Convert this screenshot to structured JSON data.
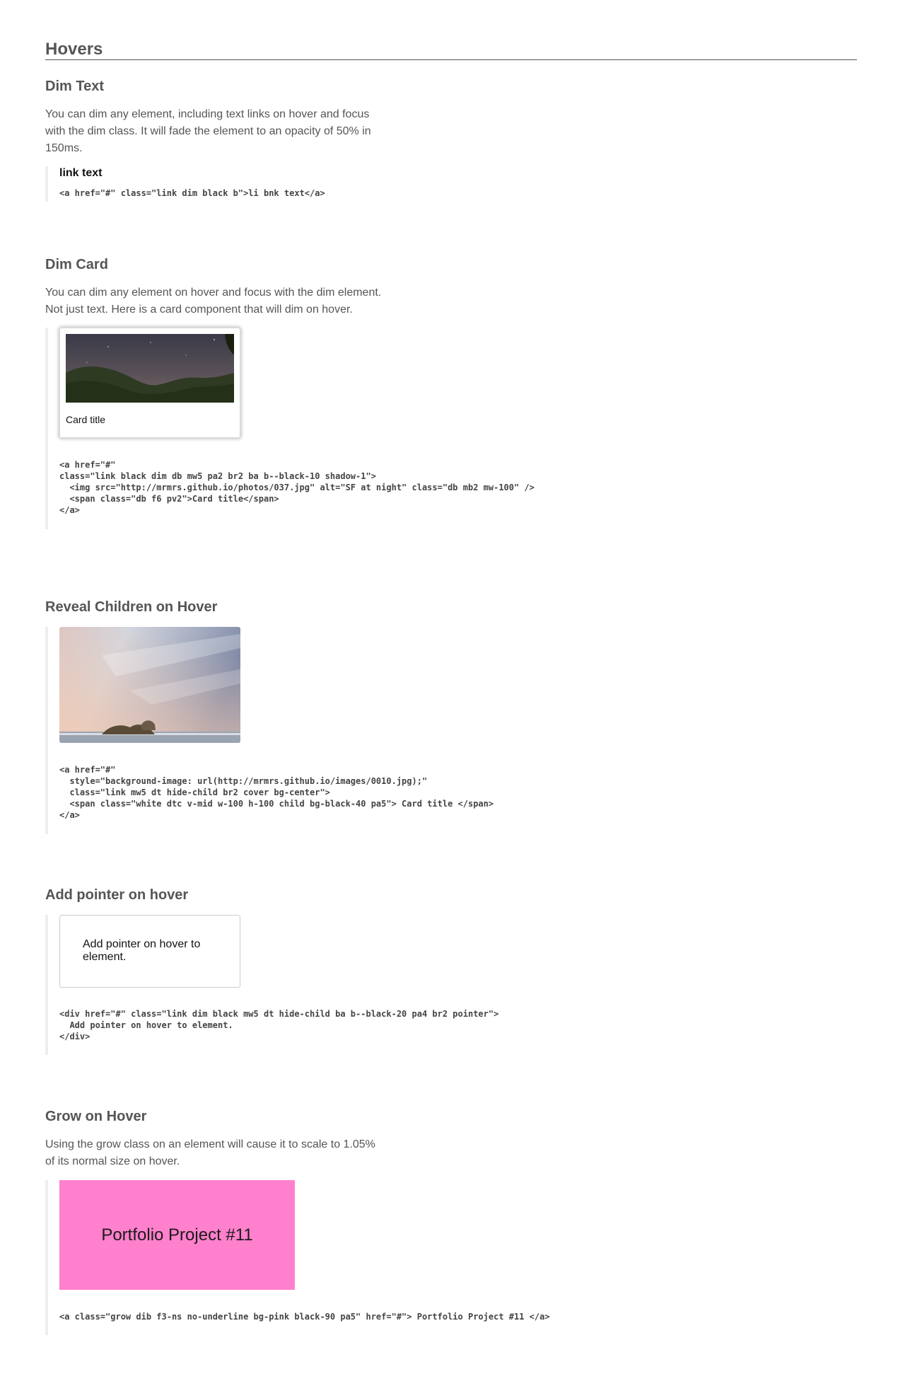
{
  "page": {
    "title": "Hovers"
  },
  "sections": {
    "dim_text": {
      "heading": "Dim Text",
      "description": "You can dim any element, including text links on hover and focus with the dim class. It will fade the element to an opacity of 50% in 150ms.",
      "link_label": "link text",
      "code": "<a href=\"#\" class=\"link dim black b\">li bnk text</a>"
    },
    "dim_card": {
      "heading": "Dim Card",
      "description": "You can dim any element on hover and focus with the dim element. Not just text. Here is a card component that will dim on hover.",
      "card_title": "Card title",
      "image_alt": "SF at night",
      "code": "<a href=\"#\"\nclass=\"link black dim db mw5 pa2 br2 ba b--black-10 shadow-1\">\n  <img src=\"http://mrmrs.github.io/photos/037.jpg\" alt=\"SF at night\" class=\"db mb2 mw-100\" />\n  <span class=\"db f6 pv2\">Card title</span>\n</a>"
    },
    "reveal_children": {
      "heading": "Reveal Children on Hover",
      "code": "<a href=\"#\"\n  style=\"background-image: url(http://mrmrs.github.io/images/0010.jpg);\"\n  class=\"link mw5 dt hide-child br2 cover bg-center\">\n  <span class=\"white dtc v-mid w-100 h-100 child bg-black-40 pa5\"> Card title </span>\n</a>"
    },
    "add_pointer": {
      "heading": "Add pointer on hover",
      "box_text": "Add pointer on hover to element.",
      "code": "<div href=\"#\" class=\"link dim black mw5 dt hide-child ba b--black-20 pa4 br2 pointer\">\n  Add pointer on hover to element.\n</div>"
    },
    "grow": {
      "heading": "Grow on Hover",
      "description": "Using the grow class on an element will cause it to scale to 1.05% of its normal size on hover.",
      "box_label": "Portfolio Project #11",
      "box_color": "#ff80cc",
      "code": "<a class=\"grow dib f3-ns no-underline bg-pink black-90 pa5\" href=\"#\"> Portfolio Project #11 </a>"
    }
  }
}
